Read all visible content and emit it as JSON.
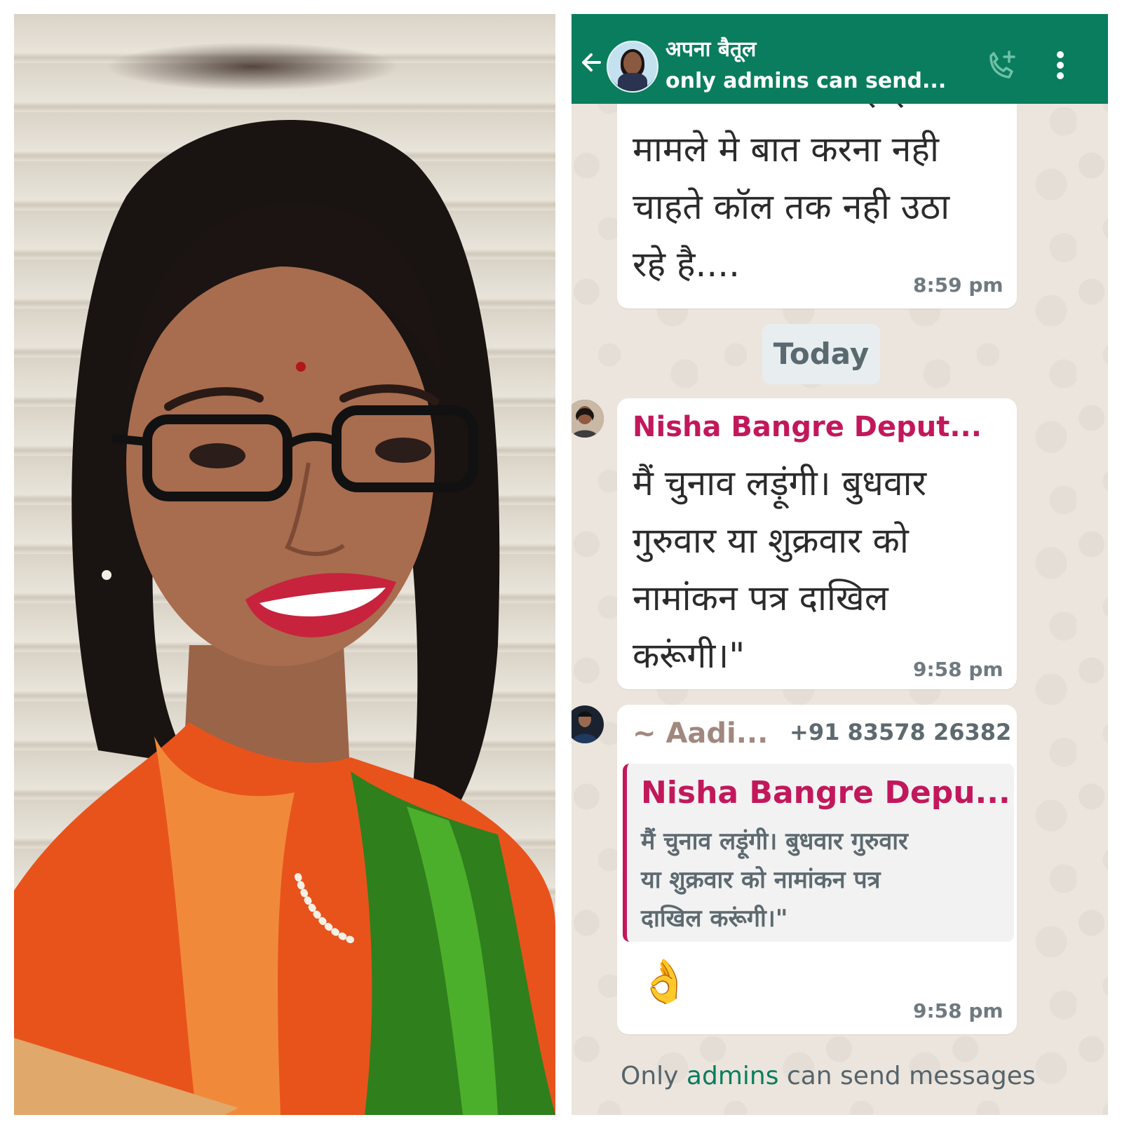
{
  "photo": {
    "subject": ""
  },
  "header": {
    "title": "अपना बैतूल",
    "subtitle": "only admins can send...",
    "icons": [
      "back-arrow-icon",
      "group-avatar",
      "add-call-icon",
      "more-vert-icon"
    ]
  },
  "colors": {
    "header_bg": "#0a7d5e",
    "chat_bg": "#ece5dd",
    "sender_pink": "#c2185b",
    "sender_brown": "#a1887f",
    "link_green": "#0a7d5e"
  },
  "messages": [
    {
      "text": "मामले मे बात करना नही\nचाहते कॉल तक नही उठा\nरहे है....",
      "partial_top": "सरकार के जन कोई इस",
      "time": "8:59 pm"
    },
    {
      "sender": "Nisha Bangre Deput...",
      "text": "मैं चुनाव लड़ूंगी। बुधवार\nगुरुवार या शुक्रवार को\nनामांकन पत्र दाखिल\nकरूंगी।\"",
      "time": "9:58 pm"
    },
    {
      "sender": "~ Aadi...",
      "phone": "+91 83578 26382",
      "quote_sender": "Nisha Bangre Depu...",
      "quote_text": "मैं चुनाव लड़ूंगी। बुधवार गुरुवार\nया शुक्रवार को नामांकन पत्र\nदाखिल करूंगी।\"",
      "emoji": "👌",
      "time": "9:58 pm"
    }
  ],
  "date_divider": "Today",
  "footer": {
    "prefix": "Only",
    "link": "admins",
    "suffix": "can send messages"
  }
}
